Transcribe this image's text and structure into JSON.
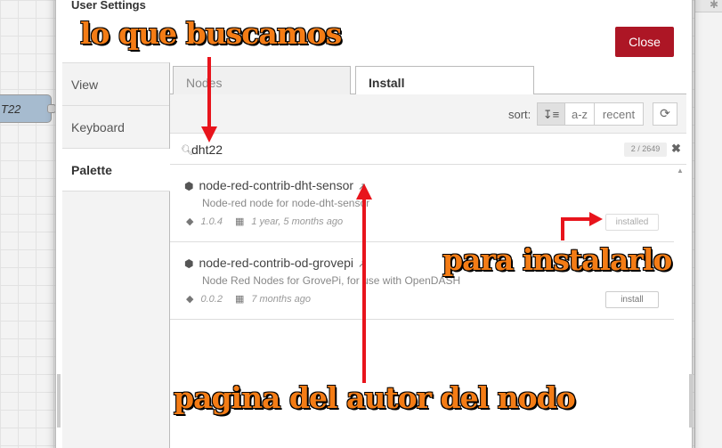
{
  "dialog": {
    "title": "User Settings",
    "close_label": "Close"
  },
  "background": {
    "node_label": "T22"
  },
  "sidebar": {
    "items": [
      {
        "label": "View"
      },
      {
        "label": "Keyboard"
      },
      {
        "label": "Palette"
      }
    ]
  },
  "tabs": {
    "nodes": "Nodes",
    "install": "Install"
  },
  "sort": {
    "label": "sort:",
    "options": [
      "↧≡",
      "a-z",
      "recent"
    ],
    "refresh_icon": "⟳"
  },
  "search": {
    "value": "dht22",
    "count": "2 / 2649",
    "clear_icon": "✖"
  },
  "packages": [
    {
      "name": "node-red-contrib-dht-sensor",
      "description": "Node-red node for node-dht-sensor",
      "version": "1.0.4",
      "updated": "1 year, 5 months ago",
      "button": "installed"
    },
    {
      "name": "node-red-contrib-od-grovepi",
      "description": "Node Red Nodes for GrovePi, for use with OpenDASH",
      "version": "0.0.2",
      "updated": "7 months ago",
      "button": "install"
    }
  ],
  "annotations": {
    "search_note": "lo que buscamos",
    "install_note": "para instalarlo",
    "author_note": "pagina del autor del nodo"
  },
  "colors": {
    "close_button": "#ad1625",
    "annotation_text": "#f47c15",
    "arrow": "#e8141c"
  }
}
